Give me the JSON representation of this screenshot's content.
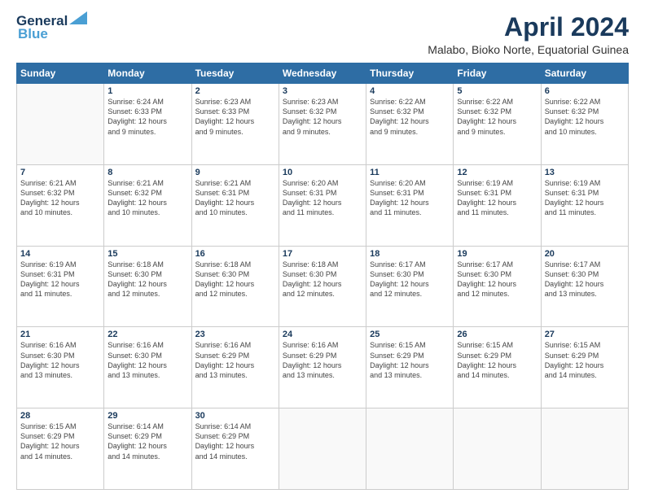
{
  "logo": {
    "line1": "General",
    "line2": "Blue"
  },
  "header": {
    "title": "April 2024",
    "subtitle": "Malabo, Bioko Norte, Equatorial Guinea"
  },
  "weekdays": [
    "Sunday",
    "Monday",
    "Tuesday",
    "Wednesday",
    "Thursday",
    "Friday",
    "Saturday"
  ],
  "weeks": [
    [
      {
        "day": "",
        "info": ""
      },
      {
        "day": "1",
        "info": "Sunrise: 6:24 AM\nSunset: 6:33 PM\nDaylight: 12 hours\nand 9 minutes."
      },
      {
        "day": "2",
        "info": "Sunrise: 6:23 AM\nSunset: 6:33 PM\nDaylight: 12 hours\nand 9 minutes."
      },
      {
        "day": "3",
        "info": "Sunrise: 6:23 AM\nSunset: 6:32 PM\nDaylight: 12 hours\nand 9 minutes."
      },
      {
        "day": "4",
        "info": "Sunrise: 6:22 AM\nSunset: 6:32 PM\nDaylight: 12 hours\nand 9 minutes."
      },
      {
        "day": "5",
        "info": "Sunrise: 6:22 AM\nSunset: 6:32 PM\nDaylight: 12 hours\nand 9 minutes."
      },
      {
        "day": "6",
        "info": "Sunrise: 6:22 AM\nSunset: 6:32 PM\nDaylight: 12 hours\nand 10 minutes."
      }
    ],
    [
      {
        "day": "7",
        "info": "Sunrise: 6:21 AM\nSunset: 6:32 PM\nDaylight: 12 hours\nand 10 minutes."
      },
      {
        "day": "8",
        "info": "Sunrise: 6:21 AM\nSunset: 6:32 PM\nDaylight: 12 hours\nand 10 minutes."
      },
      {
        "day": "9",
        "info": "Sunrise: 6:21 AM\nSunset: 6:31 PM\nDaylight: 12 hours\nand 10 minutes."
      },
      {
        "day": "10",
        "info": "Sunrise: 6:20 AM\nSunset: 6:31 PM\nDaylight: 12 hours\nand 11 minutes."
      },
      {
        "day": "11",
        "info": "Sunrise: 6:20 AM\nSunset: 6:31 PM\nDaylight: 12 hours\nand 11 minutes."
      },
      {
        "day": "12",
        "info": "Sunrise: 6:19 AM\nSunset: 6:31 PM\nDaylight: 12 hours\nand 11 minutes."
      },
      {
        "day": "13",
        "info": "Sunrise: 6:19 AM\nSunset: 6:31 PM\nDaylight: 12 hours\nand 11 minutes."
      }
    ],
    [
      {
        "day": "14",
        "info": "Sunrise: 6:19 AM\nSunset: 6:31 PM\nDaylight: 12 hours\nand 11 minutes."
      },
      {
        "day": "15",
        "info": "Sunrise: 6:18 AM\nSunset: 6:30 PM\nDaylight: 12 hours\nand 12 minutes."
      },
      {
        "day": "16",
        "info": "Sunrise: 6:18 AM\nSunset: 6:30 PM\nDaylight: 12 hours\nand 12 minutes."
      },
      {
        "day": "17",
        "info": "Sunrise: 6:18 AM\nSunset: 6:30 PM\nDaylight: 12 hours\nand 12 minutes."
      },
      {
        "day": "18",
        "info": "Sunrise: 6:17 AM\nSunset: 6:30 PM\nDaylight: 12 hours\nand 12 minutes."
      },
      {
        "day": "19",
        "info": "Sunrise: 6:17 AM\nSunset: 6:30 PM\nDaylight: 12 hours\nand 12 minutes."
      },
      {
        "day": "20",
        "info": "Sunrise: 6:17 AM\nSunset: 6:30 PM\nDaylight: 12 hours\nand 13 minutes."
      }
    ],
    [
      {
        "day": "21",
        "info": "Sunrise: 6:16 AM\nSunset: 6:30 PM\nDaylight: 12 hours\nand 13 minutes."
      },
      {
        "day": "22",
        "info": "Sunrise: 6:16 AM\nSunset: 6:30 PM\nDaylight: 12 hours\nand 13 minutes."
      },
      {
        "day": "23",
        "info": "Sunrise: 6:16 AM\nSunset: 6:29 PM\nDaylight: 12 hours\nand 13 minutes."
      },
      {
        "day": "24",
        "info": "Sunrise: 6:16 AM\nSunset: 6:29 PM\nDaylight: 12 hours\nand 13 minutes."
      },
      {
        "day": "25",
        "info": "Sunrise: 6:15 AM\nSunset: 6:29 PM\nDaylight: 12 hours\nand 13 minutes."
      },
      {
        "day": "26",
        "info": "Sunrise: 6:15 AM\nSunset: 6:29 PM\nDaylight: 12 hours\nand 14 minutes."
      },
      {
        "day": "27",
        "info": "Sunrise: 6:15 AM\nSunset: 6:29 PM\nDaylight: 12 hours\nand 14 minutes."
      }
    ],
    [
      {
        "day": "28",
        "info": "Sunrise: 6:15 AM\nSunset: 6:29 PM\nDaylight: 12 hours\nand 14 minutes."
      },
      {
        "day": "29",
        "info": "Sunrise: 6:14 AM\nSunset: 6:29 PM\nDaylight: 12 hours\nand 14 minutes."
      },
      {
        "day": "30",
        "info": "Sunrise: 6:14 AM\nSunset: 6:29 PM\nDaylight: 12 hours\nand 14 minutes."
      },
      {
        "day": "",
        "info": ""
      },
      {
        "day": "",
        "info": ""
      },
      {
        "day": "",
        "info": ""
      },
      {
        "day": "",
        "info": ""
      }
    ]
  ]
}
